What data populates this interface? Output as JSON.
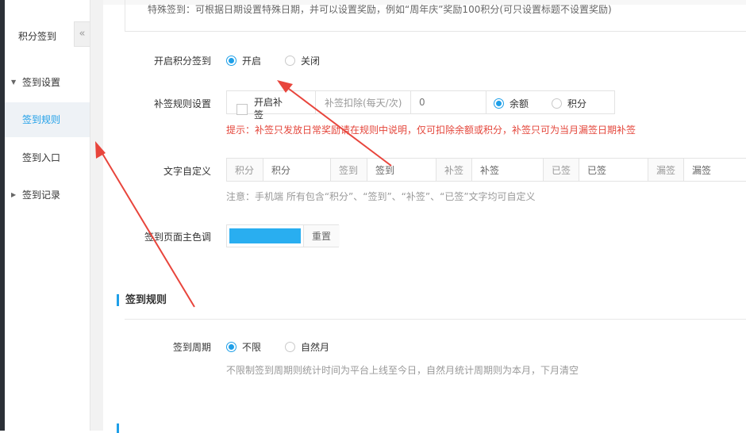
{
  "sidebar": {
    "title": "积分签到",
    "collapse_glyph": "«",
    "items": [
      {
        "label": "签到设置",
        "caret": "▼"
      },
      {
        "label": "签到规则"
      },
      {
        "label": "签到入口"
      },
      {
        "label": "签到记录",
        "caret": "▶"
      }
    ]
  },
  "top_note": "特殊签到：可根据日期设置特殊日期，并可以设置奖励，例如“周年庆”奖励100积分(可只设置标题不设置奖励)",
  "enable": {
    "label": "开启积分签到",
    "options": [
      "开启",
      "关闭"
    ],
    "selected": "开启"
  },
  "makeup": {
    "label": "补签规则设置",
    "checkbox_label_line1": "开启补",
    "checkbox_label_line2": "签",
    "deduct_label": "补签扣除(每天/次)",
    "deduct_value": "0",
    "options": [
      "余额",
      "积分"
    ],
    "selected": "余额",
    "hint": "提示：补签只发放日常奖励请在规则中说明，仅可扣除余额或积分，补签只可为当月漏签日期补签"
  },
  "custom_text": {
    "label": "文字自定义",
    "fields": [
      {
        "tag": "积分",
        "value": "积分"
      },
      {
        "tag": "签到",
        "value": "签到"
      },
      {
        "tag": "补签",
        "value": "补签"
      },
      {
        "tag": "已签",
        "value": "已签"
      },
      {
        "tag": "漏签",
        "value": "漏签"
      }
    ],
    "note": "注意：手机端 所有包含“积分”、“签到”、“补签”、“已签”文字均可自定义"
  },
  "theme_color": {
    "label": "签到页面主色调",
    "color": "#29aef0",
    "reset_label": "重置"
  },
  "section": {
    "title": "签到规则"
  },
  "period": {
    "label": "签到周期",
    "options": [
      "不限",
      "自然月"
    ],
    "selected": "不限",
    "note": "不限制签到周期则统计时间为平台上线至今日，自然月统计周期则为本月，下月清空"
  },
  "colors": {
    "accent": "#1e9fe8",
    "hint_red": "#e4463b",
    "annotation_arrow": "#e8453c"
  }
}
